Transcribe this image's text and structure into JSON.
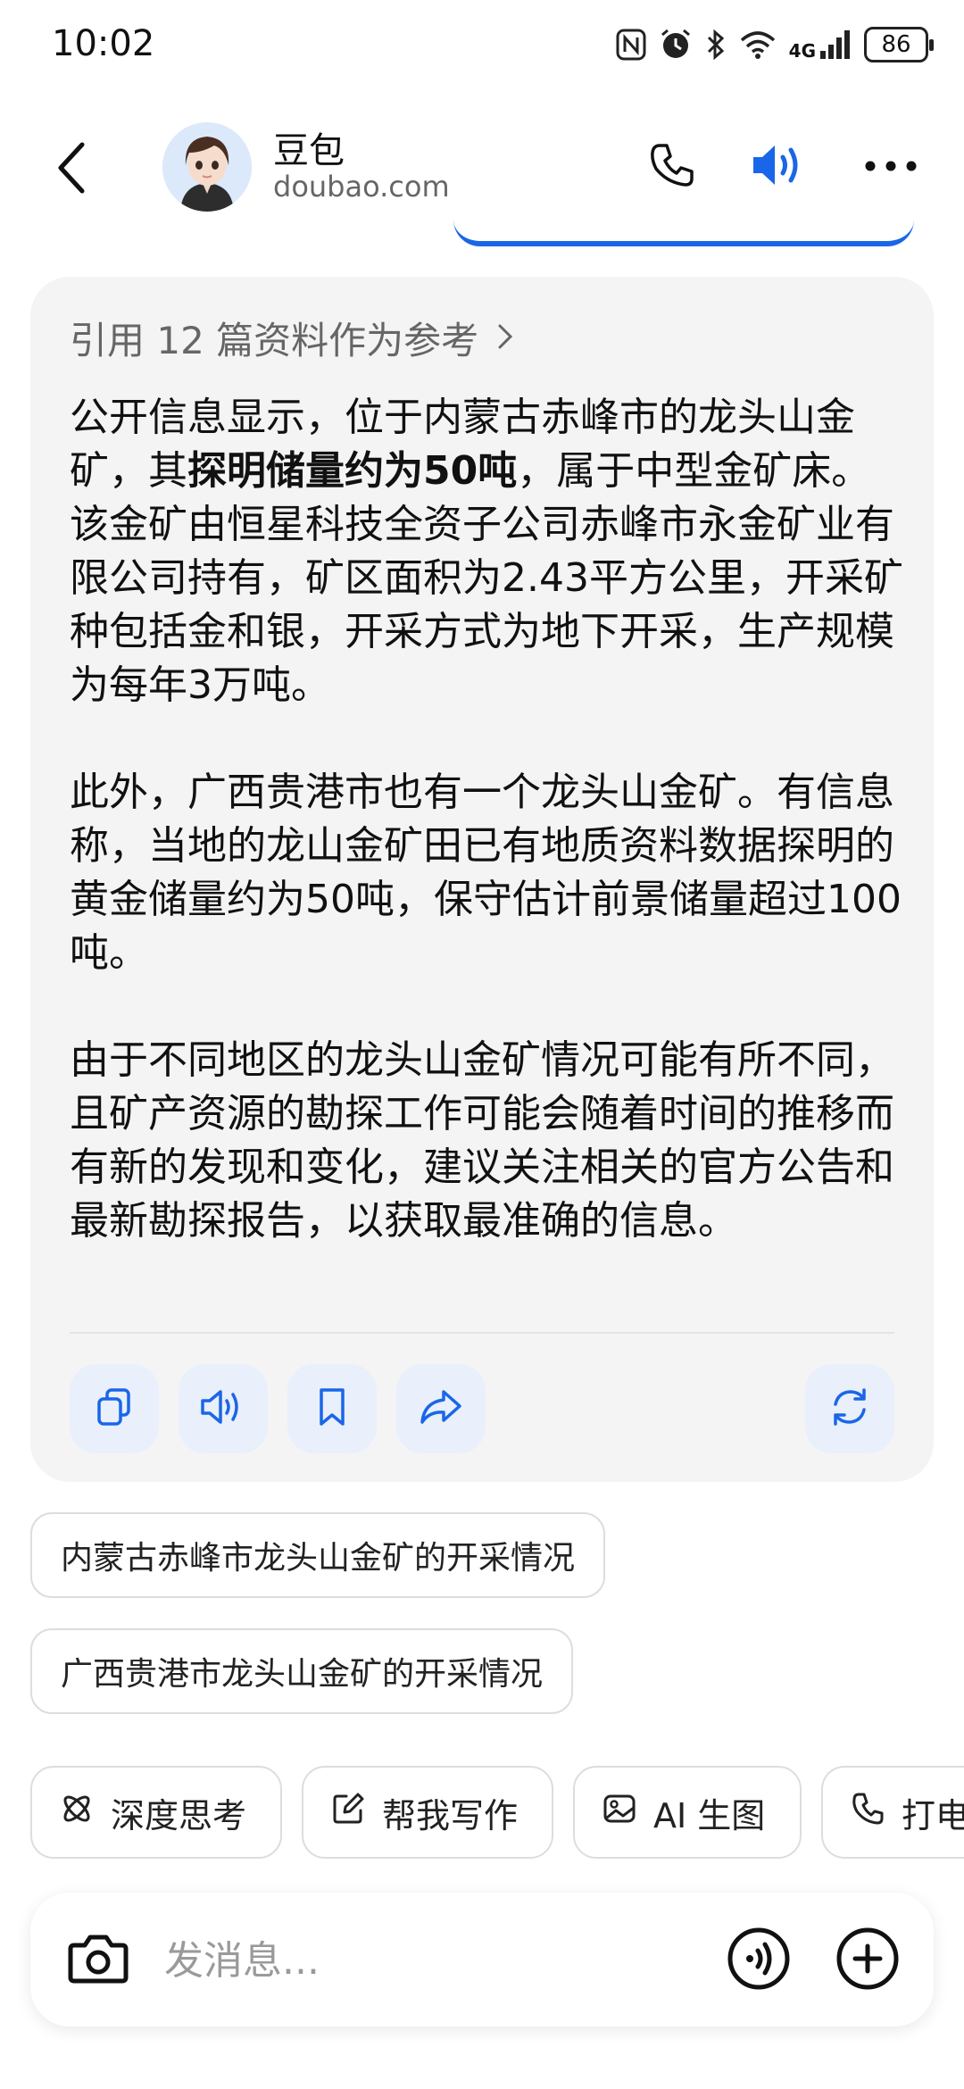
{
  "status_bar": {
    "time": "10:02",
    "network": "4G",
    "battery": "86",
    "icons": [
      "nfc-icon",
      "alarm-icon",
      "bluetooth-icon",
      "wifi-icon",
      "signal-icon",
      "battery-icon"
    ]
  },
  "header": {
    "bot_name": "豆包",
    "bot_domain": "doubao.com",
    "icons": [
      "back-arrow-icon",
      "phone-icon",
      "speaker-icon",
      "more-dots-icon"
    ],
    "accent_color": "#1a66e8"
  },
  "response": {
    "references_label": "引用 12 篇资料作为参考",
    "paragraph1_a": "公开信息显示，位于内蒙古赤峰市的龙头山金矿，其",
    "paragraph1_bold": "探明储量约为50吨",
    "paragraph1_b": "，属于中型金矿床。该金矿由恒星科技全资子公司赤峰市永金矿业有限公司持有，矿区面积为2.43平方公里，开采矿种包括金和银，开采方式为地下开采，生产规模为每年3万吨。",
    "paragraph2": "此外，广西贵港市也有一个龙头山金矿。有信息称，当地的龙山金矿田已有地质资料数据探明的黄金储量约为50吨，保守估计前景储量超过100吨。",
    "paragraph3": "由于不同地区的龙头山金矿情况可能有所不同，且矿产资源的勘探工作可能会随着时间的推移而有新的发现和变化，建议关注相关的官方公告和最新勘探报告，以获取最准确的信息。",
    "actions": [
      "copy-icon",
      "read-aloud-icon",
      "bookmark-icon",
      "share-icon",
      "regenerate-icon"
    ]
  },
  "suggestions": [
    "内蒙古赤峰市龙头山金矿的开采情况",
    "广西贵港市龙头山金矿的开采情况"
  ],
  "tools": [
    {
      "label": "深度思考",
      "icon": "deep-think-icon"
    },
    {
      "label": "帮我写作",
      "icon": "write-icon"
    },
    {
      "label": "AI 生图",
      "icon": "image-gen-icon"
    },
    {
      "label": "打电话",
      "icon": "phone-icon"
    }
  ],
  "composer": {
    "placeholder": "发消息...",
    "value": "",
    "icons": [
      "camera-icon",
      "voice-input-icon",
      "plus-icon"
    ]
  }
}
